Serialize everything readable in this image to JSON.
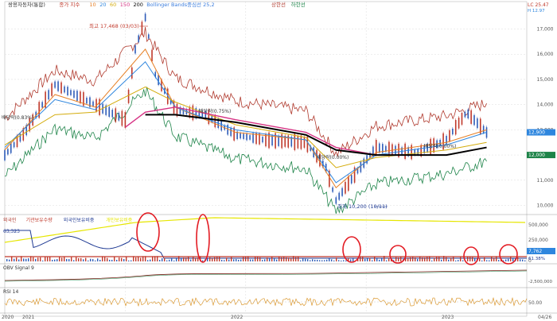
{
  "panels": {
    "price": {
      "legend": [
        {
          "text": "쌍용자동차(통합)",
          "color": "#333333"
        },
        {
          "text": "종가 지수",
          "color": "#c0392b"
        },
        {
          "text": "10",
          "color": "#e67e22"
        },
        {
          "text": "20",
          "color": "#2e86de"
        },
        {
          "text": "60",
          "color": "#d4ac0d"
        },
        {
          "text": "150",
          "color": "#d63384"
        },
        {
          "text": "200",
          "color": "#000000"
        },
        {
          "text": "Bollinger Bands중심선 25,2",
          "color": "#3b7ddd"
        },
        {
          "text": "상한선",
          "color": "#b03a2e"
        },
        {
          "text": "하한선",
          "color": "#1e8449"
        }
      ],
      "annotations": {
        "high": "최고 17,468 (03/03)",
        "low": "최저 10,200 (10/11)",
        "ex_dividend_1": "배당락(0.83%)",
        "ex_dividend_2": "배당락(0.75%)",
        "ex_dividend_3": "배당락(0.00%)",
        "ex_dividend_4": "배당락(0.00%)"
      },
      "right_top": "LC 25.47",
      "right_top2": "H 12.97",
      "price_tags": {
        "close": "12,900",
        "ma": "12,000"
      }
    },
    "volume": {
      "legend": [
        {
          "text": "외국인",
          "color": "#b03a2e"
        },
        {
          "text": "기관보유수량",
          "color": "#c0392b"
        },
        {
          "text": "외국인보유비중",
          "color": "#1f3a93"
        },
        {
          "text": "개인보유비중",
          "color": "#e6e600"
        }
      ],
      "left_value": "63,323",
      "tags": {
        "upper": "7,762",
        "lower": "61.38%"
      }
    },
    "obv": {
      "legend": "OBV Signal 9"
    },
    "rsi": {
      "legend": "RSI 14"
    }
  },
  "chart_data": {
    "type": "line",
    "title": "쌍용자동차(통합)",
    "x_ticks": [
      "2020",
      "2021",
      "2022",
      "2023",
      "04/26"
    ],
    "price_axis": {
      "ticks": [
        17000,
        16000,
        15000,
        14000,
        13000,
        12000,
        11000,
        10000
      ],
      "ylim": [
        9700,
        17900
      ]
    },
    "volume_axis": {
      "ticks": [
        "500,000",
        "250,000",
        "0"
      ]
    },
    "obv_axis": {
      "ticks": [
        "-2,500,000"
      ]
    },
    "rsi_axis": {
      "ticks": [
        "50.00"
      ]
    },
    "series": [
      {
        "name": "종가",
        "points": [
          [
            "2020-01",
            12000
          ],
          [
            "2020-03",
            12900
          ],
          [
            "2020-06",
            14800
          ],
          [
            "2020-09",
            14200
          ],
          [
            "2021-01",
            13400
          ],
          [
            "2021-02",
            16200
          ],
          [
            "2021-03",
            17468
          ],
          [
            "2021-04",
            15200
          ],
          [
            "2021-06",
            13800
          ],
          [
            "2021-09",
            13600
          ],
          [
            "2021-12",
            12800
          ],
          [
            "2022-03",
            12600
          ],
          [
            "2022-07",
            12500
          ],
          [
            "2022-09",
            11500
          ],
          [
            "2022-10",
            10200
          ],
          [
            "2022-12",
            11300
          ],
          [
            "2023-02",
            12300
          ],
          [
            "2023-06",
            12100
          ],
          [
            "2023-09",
            12600
          ],
          [
            "2023-11",
            13700
          ],
          [
            "2024-01",
            12900
          ]
        ]
      },
      {
        "name": "10",
        "points": [
          [
            "2020-01",
            12200
          ],
          [
            "2020-06",
            14400
          ],
          [
            "2020-10",
            13900
          ],
          [
            "2021-03",
            16200
          ],
          [
            "2021-06",
            13900
          ],
          [
            "2021-12",
            12900
          ],
          [
            "2022-07",
            12600
          ],
          [
            "2022-10",
            10700
          ],
          [
            "2023-02",
            12100
          ],
          [
            "2023-09",
            12500
          ],
          [
            "2024-01",
            13000
          ]
        ]
      },
      {
        "name": "20",
        "points": [
          [
            "2020-01",
            12300
          ],
          [
            "2020-06",
            14200
          ],
          [
            "2020-10",
            13800
          ],
          [
            "2021-03",
            15700
          ],
          [
            "2021-06",
            13900
          ],
          [
            "2021-12",
            13000
          ],
          [
            "2022-07",
            12600
          ],
          [
            "2022-10",
            10900
          ],
          [
            "2023-02",
            12000
          ],
          [
            "2023-09",
            12400
          ],
          [
            "2024-01",
            12900
          ]
        ]
      },
      {
        "name": "60",
        "points": [
          [
            "2020-01",
            12400
          ],
          [
            "2020-06",
            13600
          ],
          [
            "2020-10",
            13700
          ],
          [
            "2021-03",
            14700
          ],
          [
            "2021-06",
            14100
          ],
          [
            "2021-12",
            13200
          ],
          [
            "2022-07",
            12700
          ],
          [
            "2022-10",
            11500
          ],
          [
            "2023-02",
            11900
          ],
          [
            "2023-09",
            12200
          ],
          [
            "2024-01",
            12500
          ]
        ]
      },
      {
        "name": "150",
        "points": [
          [
            "2021-01",
            13100
          ],
          [
            "2021-03",
            13700
          ],
          [
            "2021-06",
            13900
          ],
          [
            "2021-12",
            13400
          ],
          [
            "2022-07",
            12900
          ],
          [
            "2022-10",
            12300
          ],
          [
            "2023-02",
            12000
          ],
          [
            "2023-09",
            12000
          ],
          [
            "2024-01",
            12300
          ]
        ]
      },
      {
        "name": "200",
        "points": [
          [
            "2021-03",
            13600
          ],
          [
            "2021-06",
            13600
          ],
          [
            "2021-12",
            13300
          ],
          [
            "2022-07",
            12800
          ],
          [
            "2022-10",
            12200
          ],
          [
            "2023-02",
            12000
          ],
          [
            "2023-09",
            12000
          ],
          [
            "2024-01",
            12300
          ]
        ]
      }
    ]
  }
}
